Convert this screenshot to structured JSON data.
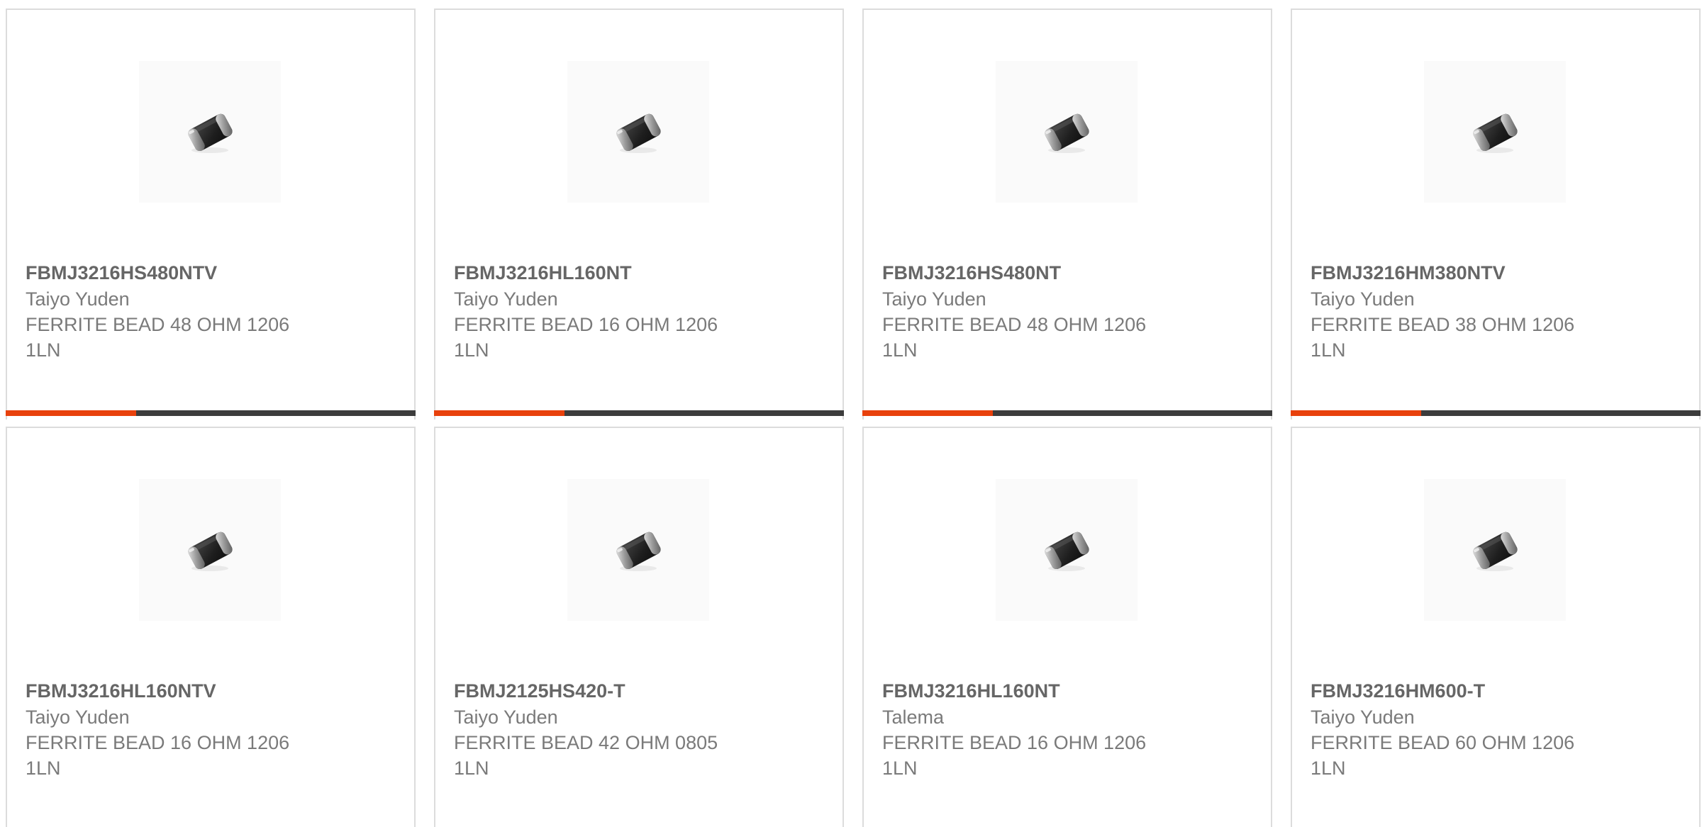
{
  "accent_color": "#e8410c",
  "bar_color": "#3c3c3c",
  "products": [
    {
      "part_number": "FBMJ3216HS480NTV",
      "manufacturer": "Taiyo Yuden",
      "description": "FERRITE BEAD 48 OHM 1206 1LN",
      "image_icon": "ferrite-bead-chip-icon"
    },
    {
      "part_number": "FBMJ3216HL160NT",
      "manufacturer": "Taiyo Yuden",
      "description": "FERRITE BEAD 16 OHM 1206 1LN",
      "image_icon": "ferrite-bead-chip-icon"
    },
    {
      "part_number": "FBMJ3216HS480NT",
      "manufacturer": "Taiyo Yuden",
      "description": "FERRITE BEAD 48 OHM 1206 1LN",
      "image_icon": "ferrite-bead-chip-icon"
    },
    {
      "part_number": "FBMJ3216HM380NTV",
      "manufacturer": "Taiyo Yuden",
      "description": "FERRITE BEAD 38 OHM 1206 1LN",
      "image_icon": "ferrite-bead-chip-icon"
    },
    {
      "part_number": "FBMJ3216HL160NTV",
      "manufacturer": "Taiyo Yuden",
      "description": "FERRITE BEAD 16 OHM 1206 1LN",
      "image_icon": "ferrite-bead-chip-icon"
    },
    {
      "part_number": "FBMJ2125HS420-T",
      "manufacturer": "Taiyo Yuden",
      "description": "FERRITE BEAD 42 OHM 0805 1LN",
      "image_icon": "ferrite-bead-chip-icon"
    },
    {
      "part_number": "FBMJ3216HL160NT",
      "manufacturer": "Talema",
      "description": "FERRITE BEAD 16 OHM 1206 1LN",
      "image_icon": "ferrite-bead-chip-icon"
    },
    {
      "part_number": "FBMJ3216HM600-T",
      "manufacturer": "Taiyo Yuden",
      "description": "FERRITE BEAD 60 OHM 1206 1LN",
      "image_icon": "ferrite-bead-chip-icon"
    }
  ]
}
